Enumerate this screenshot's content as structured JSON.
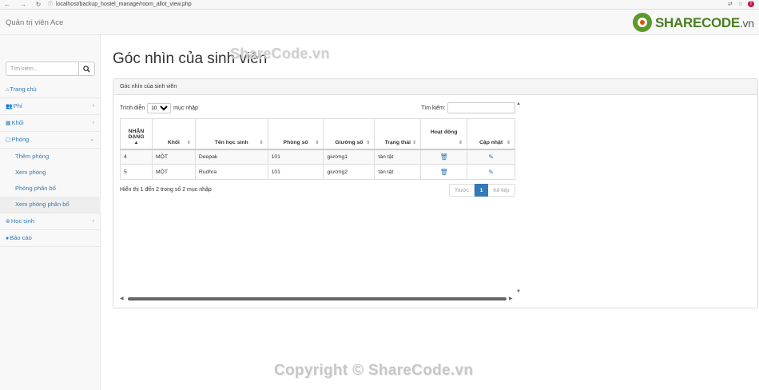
{
  "browser": {
    "url": "localhost/backup_hostel_manage/room_allot_view.php",
    "avatar_letter": "T"
  },
  "navbar": {
    "brand": "Quản trị viên Ace",
    "logo_text": "SHARECODE",
    "logo_suffix": ".vn"
  },
  "sidebar": {
    "search_placeholder": "Tìm kiếm...",
    "items": [
      {
        "label": "Trang chủ"
      },
      {
        "label": "Phí"
      },
      {
        "label": "Khối"
      },
      {
        "label": "Phòng"
      },
      {
        "label": "Thêm phòng"
      },
      {
        "label": "Xem phòng"
      },
      {
        "label": "Phòng phân bổ"
      },
      {
        "label": "Xem phòng phân bổ"
      },
      {
        "label": "Học sinh"
      },
      {
        "label": "Báo cáo"
      }
    ]
  },
  "page": {
    "title": "Góc nhìn của sinh viên",
    "watermark_top": "ShareCode.vn",
    "watermark_bottom": "Copyright © ShareCode.vn"
  },
  "panel": {
    "heading": "Góc nhìn của sinh viên",
    "length_prefix": "Trình diễn",
    "length_value": "10",
    "length_suffix": "mục nhập",
    "search_label": "Tìm kiếm:",
    "info": "Hiển thị 1 đến 2 trong số 2 mục nhập",
    "pager": {
      "prev": "Trước",
      "current": "1",
      "next": "Kế tiếp"
    }
  },
  "table": {
    "headers": [
      "NHẬN DẠNG",
      "Khối",
      "Tên học sinh",
      "Phòng số",
      "Giường số",
      "Trạng thái",
      "Hoạt động",
      "Cập nhật"
    ],
    "rows": [
      [
        "4",
        "MỘT",
        "Deepak",
        "101",
        "giường1",
        "tàn tật"
      ],
      [
        "5",
        "MỘT",
        "Rudhra",
        "101",
        "giường2",
        "tàn tật"
      ]
    ]
  }
}
